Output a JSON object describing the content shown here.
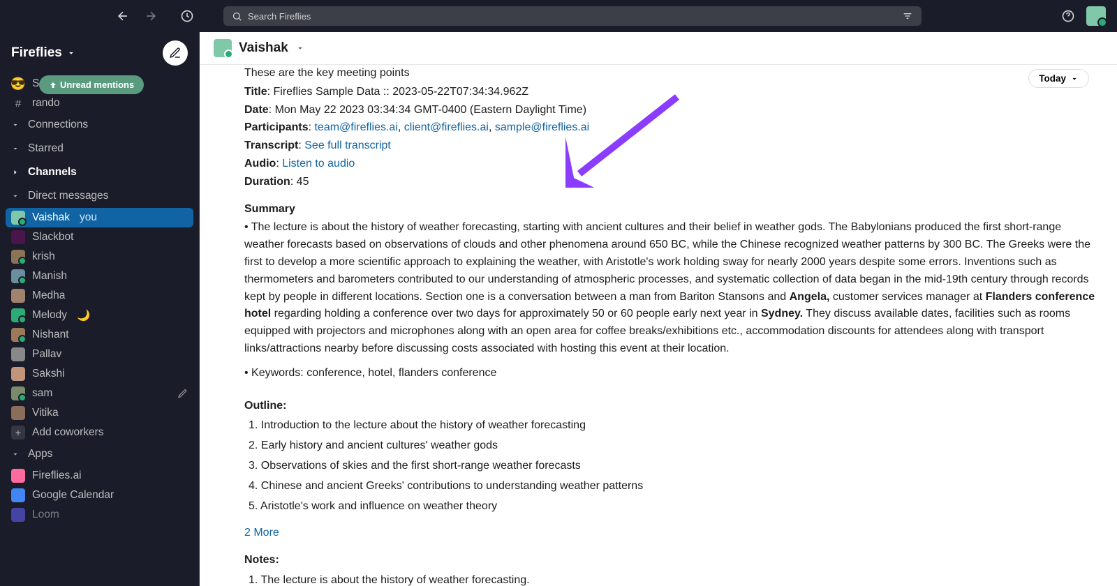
{
  "topbar": {
    "search_placeholder": "Search Fireflies"
  },
  "workspace": {
    "name": "Fireflies",
    "unread_banner": "Unread mentions"
  },
  "sidebar": {
    "truncated_item": "S",
    "channel_rando": "rando",
    "sections": {
      "connections": "Connections",
      "starred": "Starred",
      "channels": "Channels",
      "dms": "Direct messages",
      "apps": "Apps"
    },
    "dms": [
      {
        "name": "Vaishak",
        "you": "you",
        "active": true
      },
      {
        "name": "Slackbot"
      },
      {
        "name": "krish"
      },
      {
        "name": "Manish"
      },
      {
        "name": "Medha"
      },
      {
        "name": "Melody",
        "moon": true
      },
      {
        "name": "Nishant"
      },
      {
        "name": "Pallav"
      },
      {
        "name": "Sakshi"
      },
      {
        "name": "sam",
        "edit": true
      },
      {
        "name": "Vitika"
      }
    ],
    "add_coworkers": "Add coworkers",
    "apps": [
      {
        "name": "Fireflies.ai"
      },
      {
        "name": "Google Calendar"
      },
      {
        "name": "Loom"
      }
    ]
  },
  "channel_header": {
    "name": "Vaishak"
  },
  "divider": {
    "today": "Today"
  },
  "message": {
    "intro": "These are the key meeting points",
    "title_label": "Title",
    "title_value": ": Fireflies Sample Data :: 2023-05-22T07:34:34.962Z",
    "date_label": "Date",
    "date_value": ": Mon May 22 2023 03:34:34 GMT-0400 (Eastern Daylight Time)",
    "participants_label": "Participants",
    "p1": "team@fireflies.ai",
    "p2": "client@fireflies.ai",
    "p3": "sample@fireflies.ai",
    "transcript_label": "Transcript",
    "transcript_link": "See full transcript",
    "audio_label": "Audio",
    "audio_link": "Listen to audio",
    "duration_label": "Duration",
    "duration_value": ": 45",
    "summary_head": "Summary",
    "summary_bullet": "• The lecture is about the history of weather forecasting, starting with ancient cultures and their belief in weather gods. The Babylonians produced the first short-range weather forecasts based on observations of clouds and other phenomena around 650 BC, while the Chinese recognized weather patterns by 300 BC. The Greeks were the first to develop a more scientific approach to explaining the weather, with Aristotle's work holding sway for nearly 2000 years despite some errors. Inventions such as thermometers and barometers contributed to our understanding of atmospheric processes, and systematic collection of data began in the mid-19th century through records kept by people in different locations. Section one is a conversation between a man from Bariton Stansons and ",
    "summary_bold1": "Angela,",
    "summary_mid1": " customer services manager at ",
    "summary_bold2": "Flanders conference hotel",
    "summary_mid2": " regarding holding a conference over two days for approximately 50 or 60 people early next year in ",
    "summary_bold3": "Sydney.",
    "summary_tail": " They discuss available dates, facilities such as rooms equipped with projectors and microphones along with an open area for coffee breaks/exhibitions etc., accommodation discounts for attendees along with transport links/attractions nearby before discussing costs associated with hosting this event at their location.",
    "keywords": "• Keywords: conference, hotel, flanders conference",
    "outline_head": "Outline:",
    "outline": [
      "Introduction to the lecture about the history of weather forecasting",
      "Early history and ancient cultures' weather gods",
      "Observations of skies and the first short-range weather forecasts",
      "Chinese and ancient Greeks' contributions to understanding weather patterns",
      "Aristotle's work and influence on weather theory"
    ],
    "more_link": "2 More",
    "notes_head": "Notes:",
    "note1": "The lecture is about the history of weather forecasting."
  }
}
